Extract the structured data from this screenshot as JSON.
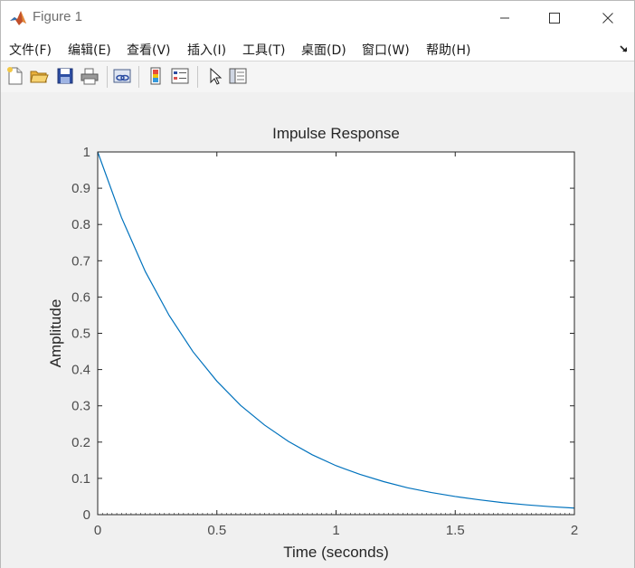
{
  "window": {
    "title": "Figure 1"
  },
  "menu": {
    "items": [
      "文件(F)",
      "编辑(E)",
      "查看(V)",
      "插入(I)",
      "工具(T)",
      "桌面(D)",
      "窗口(W)",
      "帮助(H)"
    ]
  },
  "toolbar": {
    "icons": [
      "new-figure-icon",
      "open-file-icon",
      "save-icon",
      "print-icon",
      "link-plot-icon",
      "insert-colorbar-icon",
      "insert-legend-icon",
      "edit-plot-pointer-icon",
      "property-inspector-icon"
    ]
  },
  "chart_data": {
    "type": "line",
    "title": "Impulse Response",
    "xlabel": "Time (seconds)",
    "ylabel": "Amplitude",
    "xlim": [
      0,
      2
    ],
    "ylim": [
      0,
      1
    ],
    "xticks": [
      0,
      0.5,
      1,
      1.5,
      2
    ],
    "xtick_labels": [
      "0",
      "0.5",
      "1",
      "1.5",
      "2"
    ],
    "yticks": [
      0,
      0.1,
      0.2,
      0.3,
      0.4,
      0.5,
      0.6,
      0.7,
      0.8,
      0.9,
      1
    ],
    "ytick_labels": [
      "0",
      "0.1",
      "0.2",
      "0.3",
      "0.4",
      "0.5",
      "0.6",
      "0.7",
      "0.8",
      "0.9",
      "1"
    ],
    "grid": false,
    "series": [
      {
        "color": "#0072bd",
        "x": [
          0,
          0.1,
          0.2,
          0.3,
          0.4,
          0.5,
          0.6,
          0.7,
          0.8,
          0.9,
          1.0,
          1.1,
          1.2,
          1.3,
          1.4,
          1.5,
          1.6,
          1.7,
          1.8,
          1.9,
          2.0
        ],
        "y": [
          1.0,
          0.819,
          0.67,
          0.549,
          0.449,
          0.368,
          0.301,
          0.247,
          0.202,
          0.165,
          0.135,
          0.111,
          0.091,
          0.074,
          0.061,
          0.05,
          0.041,
          0.033,
          0.027,
          0.022,
          0.018
        ]
      }
    ]
  },
  "colors": {
    "line": "#0072bd",
    "axes_bg": "#ffffff",
    "figure_bg": "#f0f0f0"
  }
}
